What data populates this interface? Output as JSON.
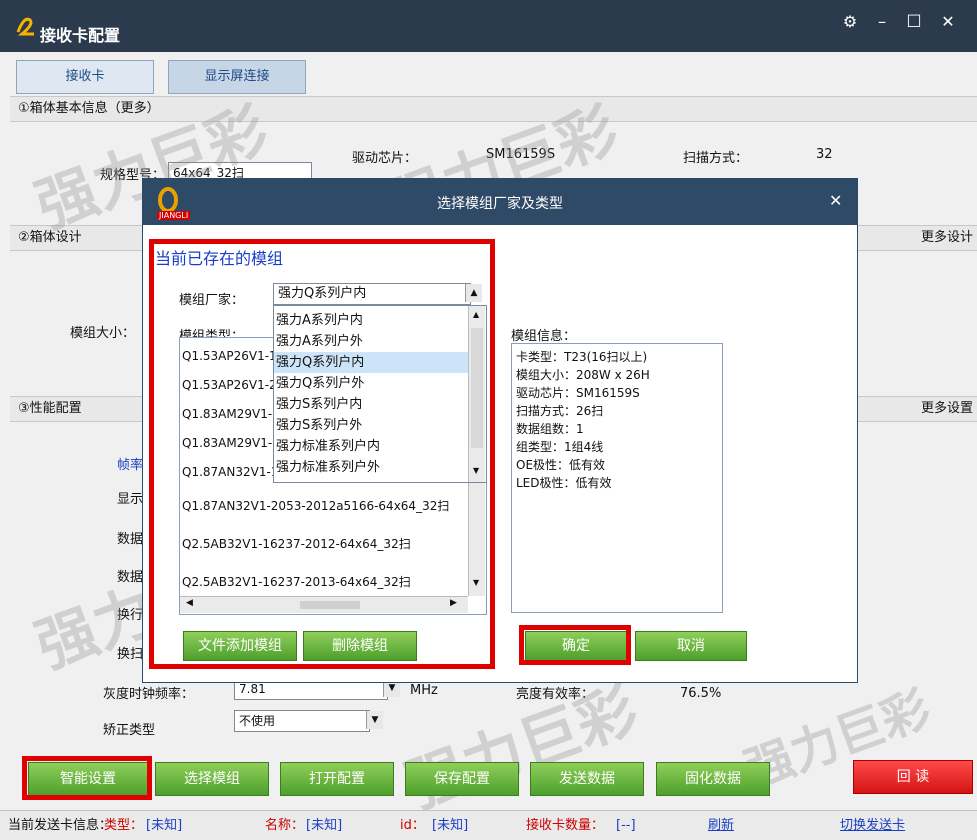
{
  "window": {
    "title": "接收卡配置",
    "icons": [
      "gear-icon",
      "minimize-icon",
      "maximize-icon",
      "close-icon"
    ]
  },
  "tabs": [
    {
      "label": "接收卡"
    },
    {
      "label": "显示屏连接"
    }
  ],
  "sections": {
    "box_info": "①箱体基本信息（更多）",
    "box_design": "②箱体设计",
    "box_design_more": "更多设计",
    "performance": "③性能配置",
    "performance_more": "更多设置"
  },
  "box_info": {
    "spec_label": "规格型号：",
    "spec_value": "64x64_32扫",
    "driver_label": "驱动芯片：",
    "driver_value": "SM16159S",
    "scan_label": "扫描方式：",
    "scan_value": "32"
  },
  "box_design": {
    "module_size_label": "模组大小："
  },
  "performance": {
    "partial_labels": [
      "帧率",
      "显示",
      "数据",
      "数据",
      "换行",
      "换扫"
    ],
    "gray_clock_label": "灰度时钟频率：",
    "gray_clock_value": "7.81",
    "gray_clock_unit": "MHz",
    "brightness_label": "亮度有效率：",
    "brightness_value": "76.5%",
    "correction_label": "矫正类型",
    "correction_value": "不使用"
  },
  "bottom_buttons": [
    "智能设置",
    "选择模组",
    "打开配置",
    "保存配置",
    "发送数据",
    "固化数据",
    "回 读"
  ],
  "status": {
    "sender_info": "当前发送卡信息：",
    "type_label": "类型：",
    "type_value": "[未知]",
    "name_label": "名称：",
    "name_value": "[未知]",
    "id_label": "id：",
    "id_value": "[未知]",
    "count_label": "接收卡数量：",
    "count_value": "[--]",
    "refresh": "刷新",
    "switch": "切换发送卡"
  },
  "dialog": {
    "title": "选择模组厂家及类型",
    "logo_text": "JIANGLI",
    "existing_heading": "当前已存在的模组",
    "vendor_label": "模组厂家：",
    "vendor_value": "强力Q系列户内",
    "type_label": "模组类型：",
    "vendor_options": [
      "强力A系列户内",
      "强力A系列户外",
      "强力Q系列户内",
      "强力Q系列户外",
      "强力S系列户内",
      "强力S系列户外",
      "强力标准系列户内",
      "强力标准系列户外"
    ],
    "vendor_selected_index": 2,
    "type_rows": [
      "Q1.53AP26V1-1",
      "Q1.53AP26V1-2",
      "Q1.83AM29V1-1",
      "Q1.83AM29V1-2",
      "Q1.87AN32V1-1",
      "Q1.87AN32V1-2053-2012a5166-64x64_32扫",
      "Q2.5AB32V1-16237-2012-64x64_32扫",
      "Q2.5AB32V1-16237-2013-64x64_32扫"
    ],
    "info_label": "模组信息：",
    "info_lines": [
      "卡类型：T23(16扫以上)",
      "模组大小：208W x 26H",
      "驱动芯片：SM16159S",
      "扫描方式：26扫",
      "数据组数：1",
      "组类型：1组4线",
      "OE极性：低有效",
      "LED极性：低有效"
    ],
    "add_button": "文件添加模组",
    "delete_button": "删除模组",
    "ok_button": "确定",
    "cancel_button": "取消"
  },
  "watermark": "强力巨彩",
  "colors": {
    "titlebar": "#2b3a4c",
    "button_green": "#5aa832",
    "readback_red": "#e02020",
    "highlight_red": "#e00000",
    "link_blue": "#1a3fc4"
  }
}
